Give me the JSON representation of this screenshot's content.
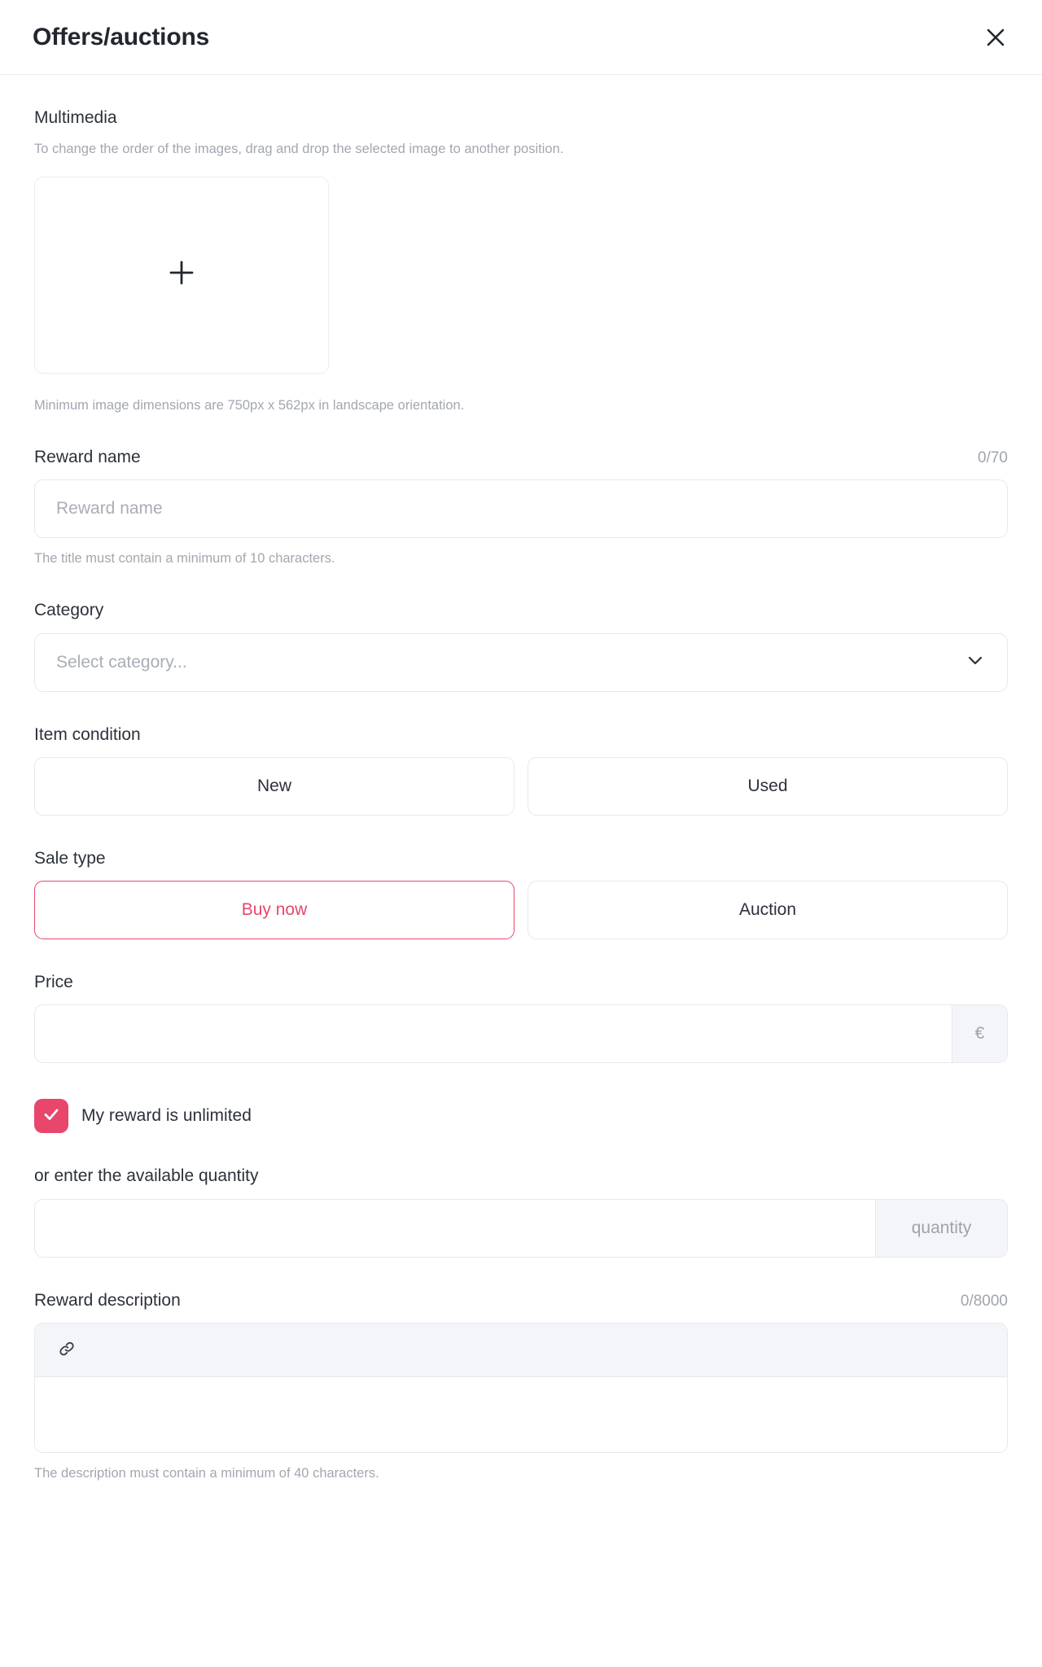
{
  "header": {
    "title": "Offers/auctions",
    "close_icon": "close-icon"
  },
  "multimedia": {
    "label": "Multimedia",
    "hint": "To change the order of the images, drag and drop the selected image to another position.",
    "upload_icon": "plus-icon",
    "min_dimensions_note": "Minimum image dimensions are 750px x 562px in landscape orientation."
  },
  "reward_name": {
    "label": "Reward name",
    "counter": "0/70",
    "value": "",
    "placeholder": "Reward name",
    "note": "The title must contain a minimum of 10 characters."
  },
  "category": {
    "label": "Category",
    "selected": "Select category...",
    "chevron_icon": "chevron-down-icon"
  },
  "item_condition": {
    "label": "Item condition",
    "options": [
      {
        "label": "New",
        "selected": false
      },
      {
        "label": "Used",
        "selected": false
      }
    ]
  },
  "sale_type": {
    "label": "Sale type",
    "options": [
      {
        "label": "Buy now",
        "selected": true
      },
      {
        "label": "Auction",
        "selected": false
      }
    ]
  },
  "price": {
    "label": "Price",
    "value": "",
    "placeholder": "",
    "currency_suffix": "€"
  },
  "unlimited": {
    "label": "My reward is unlimited",
    "checked": true,
    "check_icon": "checkmark-icon"
  },
  "quantity": {
    "label": "or enter the available quantity",
    "value": "",
    "placeholder": "",
    "suffix": "quantity"
  },
  "reward_description": {
    "label": "Reward description",
    "counter": "0/8000",
    "value": "",
    "toolbar": [
      {
        "icon": "link-icon",
        "name": "insert-link-button"
      }
    ],
    "note": "The description must contain a minimum of 40 characters."
  },
  "colors": {
    "accent": "#e8466b",
    "text": "#2c313a",
    "muted": "#a3a7b0",
    "border": "#e7e8ed",
    "addon_bg": "#f4f5f8"
  }
}
